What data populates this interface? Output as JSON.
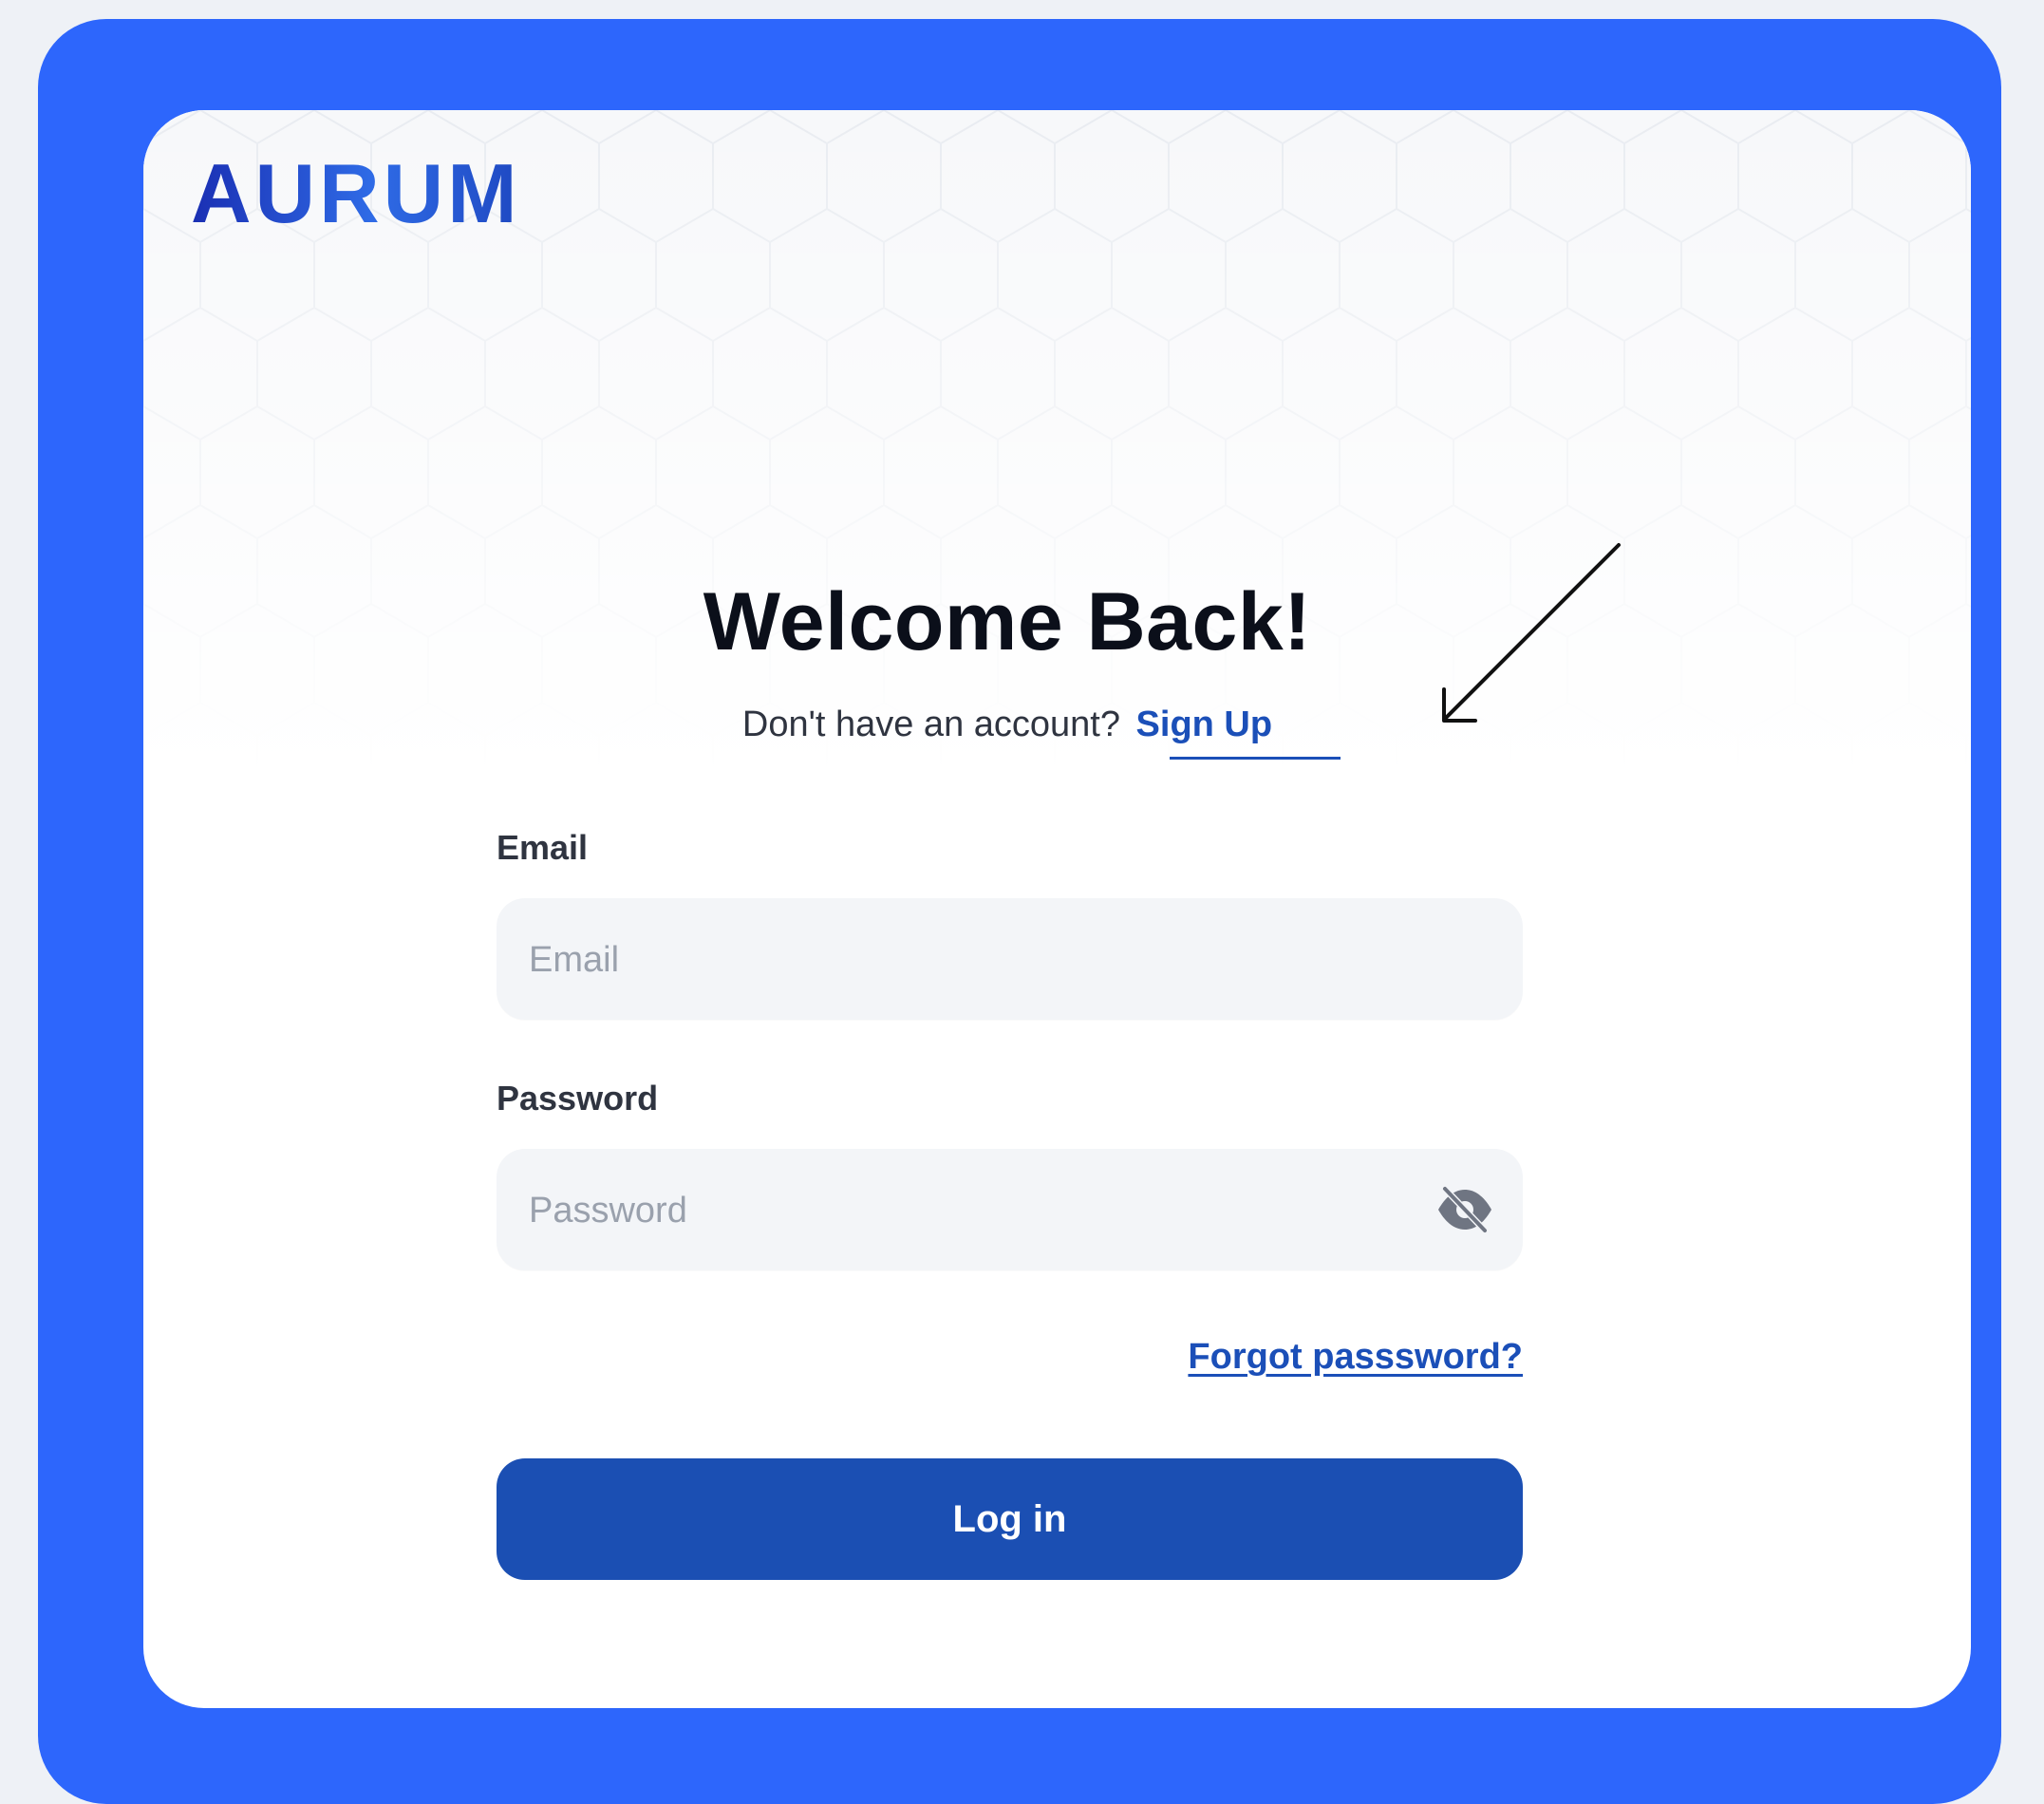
{
  "brand": {
    "logo_text": "AURUM",
    "frame_color": "#2d66fc",
    "primary_color": "#1b4fb3",
    "link_color": "#1b4fb8"
  },
  "heading": {
    "title": "Welcome Back!",
    "signup_prompt": "Don't have an account?",
    "signup_link": "Sign Up"
  },
  "form": {
    "email": {
      "label": "Email",
      "placeholder": "Email",
      "value": ""
    },
    "password": {
      "label": "Password",
      "placeholder": "Password",
      "value": "",
      "toggle_icon": "eye-off-icon"
    },
    "forgot_link": "Forgot passsword?",
    "submit_label": "Log in"
  },
  "annotation": {
    "icon": "arrow-down-left-icon"
  }
}
